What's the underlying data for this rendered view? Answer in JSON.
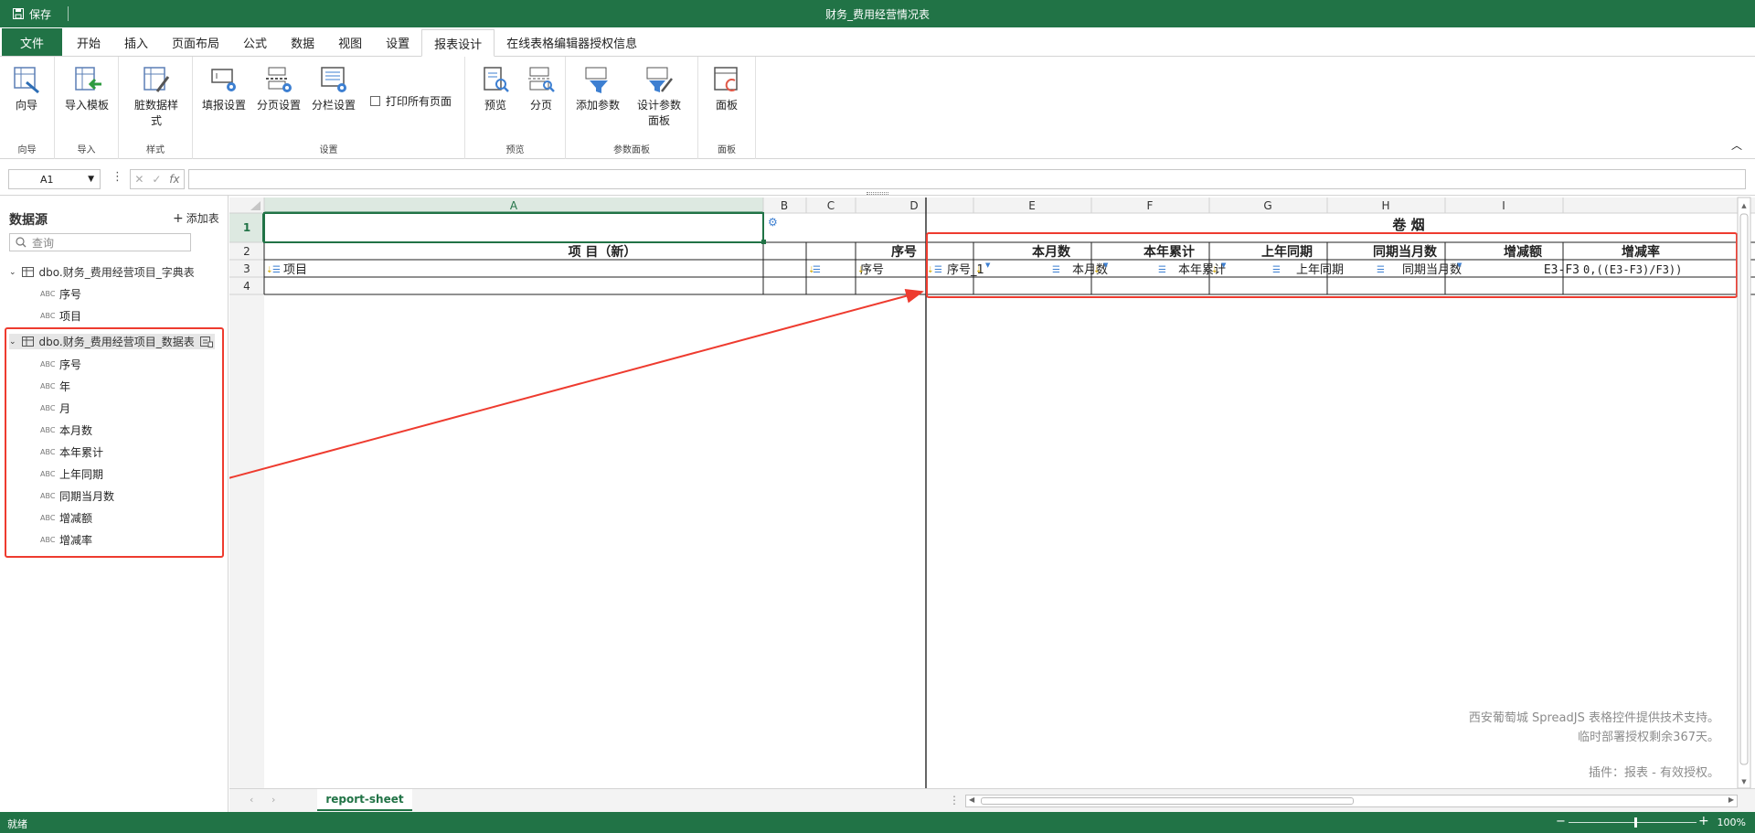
{
  "titlebar": {
    "save_label": "保存",
    "title": "财务_费用经营情况表"
  },
  "tabs": [
    {
      "label": "文件"
    },
    {
      "label": "开始"
    },
    {
      "label": "插入"
    },
    {
      "label": "页面布局"
    },
    {
      "label": "公式"
    },
    {
      "label": "数据"
    },
    {
      "label": "视图"
    },
    {
      "label": "设置"
    },
    {
      "label": "报表设计"
    },
    {
      "label": "在线表格编辑器授权信息"
    }
  ],
  "active_tab": "报表设计",
  "ribbon": {
    "groups": [
      {
        "label": "向导",
        "buttons": [
          {
            "label": "向导",
            "icon": "wizard-icon"
          }
        ]
      },
      {
        "label": "导入",
        "buttons": [
          {
            "label": "导入模板",
            "icon": "import-template-icon"
          }
        ]
      },
      {
        "label": "样式",
        "buttons": [
          {
            "label": "脏数据样式",
            "icon": "dirty-data-style-icon"
          }
        ]
      },
      {
        "label": "设置",
        "buttons": [
          {
            "label": "填报设置",
            "icon": "fill-settings-icon"
          },
          {
            "label": "分页设置",
            "icon": "page-settings-icon"
          },
          {
            "label": "分栏设置",
            "icon": "column-settings-icon"
          }
        ],
        "checkbox": "打印所有页面"
      },
      {
        "label": "预览",
        "buttons": [
          {
            "label": "预览",
            "icon": "preview-icon"
          },
          {
            "label": "分页",
            "icon": "paging-icon"
          }
        ]
      },
      {
        "label": "参数面板",
        "buttons": [
          {
            "label": "添加参数",
            "icon": "add-param-icon"
          },
          {
            "label": "设计参数面板",
            "icon": "design-param-panel-icon"
          }
        ]
      },
      {
        "label": "面板",
        "buttons": [
          {
            "label": "面板",
            "icon": "panel-icon"
          }
        ]
      }
    ]
  },
  "formula_bar": {
    "cell_ref": "A1",
    "fx": "fx",
    "value": ""
  },
  "datasource": {
    "title": "数据源",
    "add_table": "添加表",
    "search_placeholder": "查询",
    "tables": [
      {
        "name": "dbo.财务_费用经营项目_字典表",
        "fields": [
          "序号",
          "项目"
        ]
      },
      {
        "name": "dbo.财务_费用经营项目_数据表",
        "fields": [
          "序号",
          "年",
          "月",
          "本月数",
          "本年累计",
          "上年同期",
          "同期当月数",
          "增减额",
          "增减率"
        ]
      }
    ],
    "field_type_label": "ABC"
  },
  "sheet": {
    "columns": [
      "A",
      "B",
      "C",
      "D",
      "E",
      "F",
      "G",
      "H",
      "I"
    ],
    "rows": [
      "1",
      "2",
      "3",
      "4"
    ],
    "row1_title": "卷    烟",
    "row2": {
      "A": "项          目（新）",
      "B": "序号",
      "C": "",
      "D": "本月数",
      "E": "本年累计",
      "F": "上年同期",
      "G": "同期当月数",
      "H": "增减额",
      "I": "增减率"
    },
    "row3": {
      "A": "项目",
      "B": "序号",
      "C": "序号_1",
      "D": "本月数",
      "E": "本年累计",
      "F": "上年同期",
      "G": "同期当月数",
      "H": "E3-F3",
      "I": "0,((E3-F3)/F3))"
    },
    "watermark": [
      "西安葡萄城 SpreadJS 表格控件提供技术支持。",
      "临时部署授权剩余367天。",
      "插件：报表 - 有效授权。"
    ]
  },
  "sheet_tabs": [
    "report-sheet"
  ],
  "status": {
    "ready": "就绪",
    "zoom": "100%"
  },
  "colors": {
    "brand": "#217346",
    "annotation": "#ee3b2f",
    "selection": "#217346"
  }
}
